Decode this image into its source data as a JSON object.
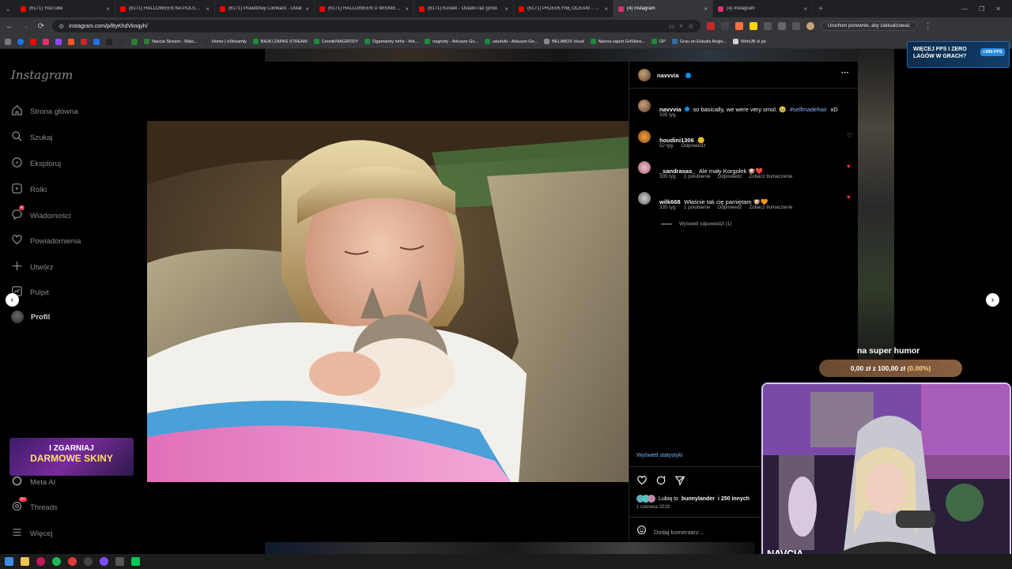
{
  "browser": {
    "tabs": [
      {
        "title": "(6171) YouTube",
        "color": "#ff0000"
      },
      {
        "title": "(6171) HALLOWEEN NA POLSKIM",
        "color": "#ff0000"
      },
      {
        "title": "(6171) Prawdziwy Lombard - Ostat",
        "color": "#ff0000"
      },
      {
        "title": "(6171) HALLOWEEN U WIŚNIEWSK",
        "color": "#ff0000"
      },
      {
        "title": "(6171) Kostek - Ostatni raz (prod.",
        "color": "#ff0000"
      },
      {
        "title": "(6171) PRZEPŁYNĘ OCEAN! - YouT",
        "color": "#ff0000"
      },
      {
        "title": "(4) Instagram",
        "color": "#e1306c",
        "active": true
      },
      {
        "title": "(4) Instagram",
        "color": "#e1306c"
      }
    ],
    "new_tab": "+",
    "url": "instagram.com/p/ByKhdVknqyh/",
    "restart_label": "Uruchom ponownie, aby zaktualizować",
    "bookmarks": [
      {
        "label": "Navcia Stream - Watc...",
        "color": "#2e7d32"
      },
      {
        "label": "Home | eStreamly",
        "color": "#333333"
      },
      {
        "label": "BAJKI ZAPAS STREAM",
        "color": "#1b8a3a"
      },
      {
        "label": "Cennik/NAGRODY",
        "color": "#1b8a3a"
      },
      {
        "label": "Ogarniemy hehe - Ark...",
        "color": "#1b8a3a"
      },
      {
        "label": "nagrody - Arkusze Go...",
        "color": "#1b8a3a"
      },
      {
        "label": "uwufufu - Arkusze Go...",
        "color": "#1b8a3a"
      },
      {
        "label": "BELABOX cloud",
        "color": "#888888"
      },
      {
        "label": "Navcia raport G4Skins...",
        "color": "#1b8a3a"
      },
      {
        "label": "DP",
        "color": "#1b8a3a"
      },
      {
        "label": "Grau en Estudis Angle...",
        "color": "#3a6aa8"
      },
      {
        "label": "MónUB el po",
        "color": "#d0d0d0"
      }
    ]
  },
  "sidebar": {
    "logo": "Instagram",
    "items": [
      {
        "label": "Strona główna",
        "icon": "home-icon"
      },
      {
        "label": "Szukaj",
        "icon": "search-icon"
      },
      {
        "label": "Eksploruj",
        "icon": "compass-icon"
      },
      {
        "label": "Rolki",
        "icon": "reels-icon"
      },
      {
        "label": "Wiadomości",
        "icon": "messenger-icon",
        "badge": "4"
      },
      {
        "label": "Powiadomienia",
        "icon": "heart-icon"
      },
      {
        "label": "Utwórz",
        "icon": "plus-icon"
      },
      {
        "label": "Pulpit",
        "icon": "dashboard-icon"
      },
      {
        "label": "Profil",
        "icon": "avatar-icon"
      },
      {
        "label": "Meta AI",
        "icon": "meta-ai-icon"
      },
      {
        "label": "Threads",
        "icon": "threads-icon",
        "badge": "9+"
      },
      {
        "label": "Więcej",
        "icon": "menu-icon"
      }
    ]
  },
  "post": {
    "author": "navvvia",
    "more": "···",
    "caption": {
      "user": "navvvia",
      "text": "so basically, we were very smol. 🥹",
      "hashtag": "#selfmadehair",
      "suffix": "xD",
      "time": "335 tyg."
    },
    "comments": [
      {
        "user": "houdini1306",
        "text": "😊",
        "time": "52 tyg.",
        "likes": "",
        "reply": "Odpowiedz",
        "translate": "",
        "liked": false
      },
      {
        "user": "_sandrasas_",
        "text": "Ale mały Korgolek 🐶❤️",
        "time": "335 tyg.",
        "likes": "1 polubienie",
        "reply": "Odpowiedz",
        "translate": "Zobacz tłumaczenie",
        "liked": true
      },
      {
        "user": "wilk668",
        "text": "Właśnie tak cię pamiętam 🐶🧡",
        "time": "335 tyg.",
        "likes": "1 polubienie",
        "reply": "Odpowiedz",
        "translate": "Zobacz tłumaczenie",
        "liked": true
      }
    ],
    "view_replies": "Wyświetl odpowiedzi (1)",
    "stats_link": "Wyświetl statystyki",
    "likes_prefix": "Lubią to",
    "likes_user": "bunnylander",
    "likes_suffix": "i 250 innych",
    "date": "1 czerwca 2019",
    "comment_placeholder": "Dodaj komentarz..."
  },
  "overlays": {
    "promo_line1": "WIĘCEJ FPS I ZERO",
    "promo_line2": "LAGÓW W GRACH?",
    "promo_badge": "+200 FPS",
    "skins_line1": "I ZGARNIAJ",
    "skins_line2": "DARMOWE SKINY",
    "superhumor": "na super humor",
    "donation": "0,00 zł z 100,00 zł",
    "donation_pct": "(0.00%)",
    "webcam_name": "NAVCIA"
  },
  "colors": {
    "accent_blue": "#0095f6",
    "like_red": "#ff3040",
    "hashtag": "#e0f1ff"
  }
}
